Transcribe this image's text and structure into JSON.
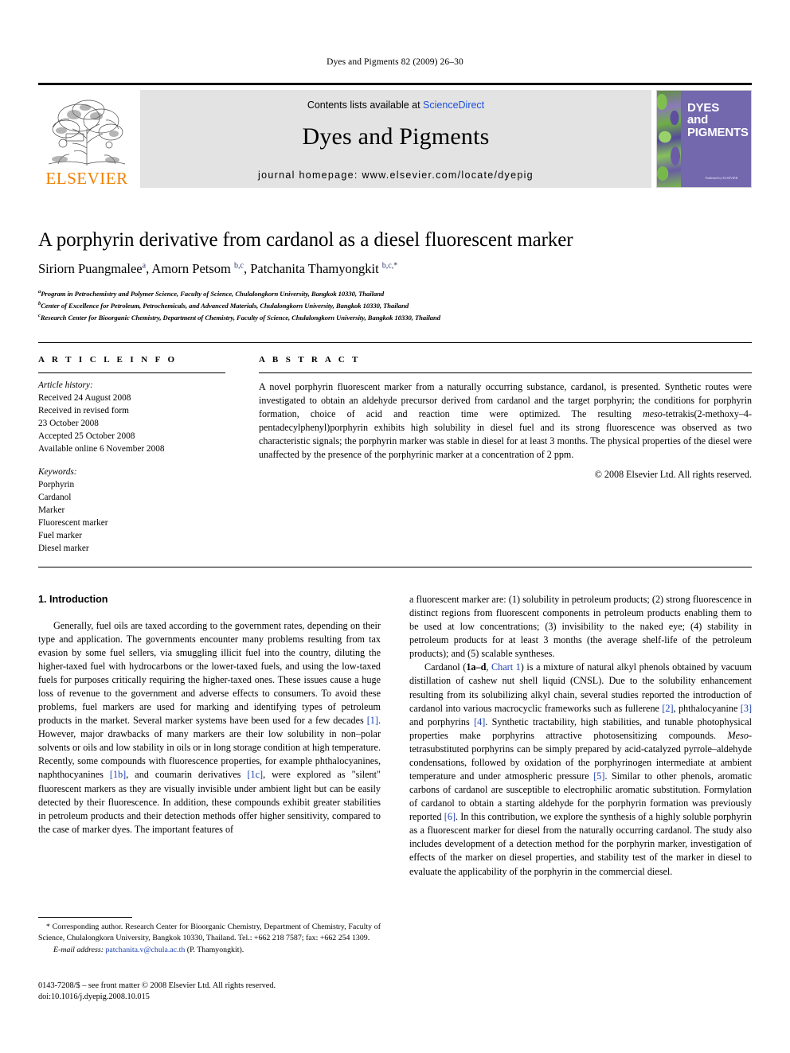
{
  "running_head": "Dyes and Pigments 82 (2009) 26–30",
  "masthead": {
    "publisher_wordmark": "ELSEVIER",
    "contents_prefix": "Contents lists available at ",
    "contents_link": "ScienceDirect",
    "journal_name": "Dyes and Pigments",
    "homepage": "journal homepage: www.elsevier.com/locate/dyepig",
    "cover": {
      "line1": "DYES",
      "line2": "and",
      "line3": "PIGMENTS",
      "footer": "Published by ELSEVIER",
      "background_color": "#7367AE",
      "wordmark_color": "#F08000"
    }
  },
  "article": {
    "title": "A porphyrin derivative from cardanol as a diesel fluorescent marker",
    "authors": [
      {
        "name": "Siriorn Puangmalee",
        "marks": "a"
      },
      {
        "name": "Amorn Petsom",
        "marks": "b,c"
      },
      {
        "name": "Patchanita Thamyongkit",
        "marks": "b,c,*"
      }
    ],
    "authors_line": "Siriorn Puangmalee a, Amorn Petsom b,c, Patchanita Thamyongkit b,c,*",
    "affiliations": [
      {
        "mark": "a",
        "text": "Program in Petrochemistry and Polymer Science, Faculty of Science, Chulalongkorn University, Bangkok 10330, Thailand"
      },
      {
        "mark": "b",
        "text": "Center of Excellence for Petroleum, Petrochemicals, and Advanced Materials, Chulalongkorn University, Bangkok 10330, Thailand"
      },
      {
        "mark": "c",
        "text": "Research Center for Bioorganic Chemistry, Department of Chemistry, Faculty of Science, Chulalongkorn University, Bangkok 10330, Thailand"
      }
    ]
  },
  "article_info": {
    "heading": "A R T I C L E   I N F O",
    "history_label": "Article history:",
    "history": [
      "Received 24 August 2008",
      "Received in revised form",
      "23 October 2008",
      "Accepted 25 October 2008",
      "Available online 6 November 2008"
    ],
    "keywords_label": "Keywords:",
    "keywords": [
      "Porphyrin",
      "Cardanol",
      "Marker",
      "Fluorescent marker",
      "Fuel marker",
      "Diesel marker"
    ]
  },
  "abstract": {
    "heading": "A B S T R A C T",
    "text": "A novel porphyrin fluorescent marker from a naturally occurring substance, cardanol, is presented. Synthetic routes were investigated to obtain an aldehyde precursor derived from cardanol and the target porphyrin; the conditions for porphyrin formation, choice of acid and reaction time were optimized. The resulting meso-tetrakis(2-methoxy–4-pentadecylphenyl)porphyrin exhibits high solubility in diesel fuel and its strong fluorescence was observed as two characteristic signals; the porphyrin marker was stable in diesel for at least 3 months. The physical properties of the diesel were unaffected by the presence of the porphyrinic marker at a concentration of 2 ppm.",
    "copyright": "© 2008 Elsevier Ltd. All rights reserved."
  },
  "body": {
    "section_number_title": "1.  Introduction",
    "left_paragraph": "Generally, fuel oils are taxed according to the government rates, depending on their type and application. The governments encounter many problems resulting from tax evasion by some fuel sellers, via smuggling illicit fuel into the country, diluting the higher-taxed fuel with hydrocarbons or the lower-taxed fuels, and using the low-taxed fuels for purposes critically requiring the higher-taxed ones. These issues cause a huge loss of revenue to the government and adverse effects to consumers. To avoid these problems, fuel markers are used for marking and identifying types of petroleum products in the market. Several marker systems have been used for a few decades [1]. However, major drawbacks of many markers are their low solubility in non–polar solvents or oils and low stability in oils or in long storage condition at high temperature. Recently, some compounds with fluorescence properties, for example phthalocyanines, naphthocyanines [1b], and coumarin derivatives [1c], were explored as \"silent\" fluorescent markers as they are visually invisible under ambient light but can be easily detected by their fluorescence. In addition, these compounds exhibit greater stabilities in petroleum products and their detection methods offer higher sensitivity, compared to the case of marker dyes. The important features of",
    "right_paragraph_1": "a fluorescent marker are: (1) solubility in petroleum products; (2) strong fluorescence in distinct regions from fluorescent components in petroleum products enabling them to be used at low concentrations; (3) invisibility to the naked eye; (4) stability in petroleum products for at least 3 months (the average shelf-life of the petroleum products); and (5) scalable syntheses.",
    "right_paragraph_2": "Cardanol (1a–d, Chart 1) is a mixture of natural alkyl phenols obtained by vacuum distillation of cashew nut shell liquid (CNSL). Due to the solubility enhancement resulting from its solubilizing alkyl chain, several studies reported the introduction of cardanol into various macrocyclic frameworks such as fullerene [2], phthalocyanine [3] and porphyrins [4]. Synthetic tractability, high stabilities, and tunable photophysical properties make porphyrins attractive photosensitizing compounds. Meso-tetrasubstituted porphyrins can be simply prepared by acid-catalyzed pyrrole–aldehyde condensations, followed by oxidation of the porphyrinogen intermediate at ambient temperature and under atmospheric pressure [5]. Similar to other phenols, aromatic carbons of cardanol are susceptible to electrophilic aromatic substitution. Formylation of cardanol to obtain a starting aldehyde for the porphyrin formation was previously reported [6]. In this contribution, we explore the synthesis of a highly soluble porphyrin as a fluorescent marker for diesel from the naturally occurring cardanol. The study also includes development of a detection method for the porphyrin marker, investigation of effects of the marker on diesel properties, and stability test of the marker in diesel to evaluate the applicability of the porphyrin in the commercial diesel."
  },
  "footnote": {
    "corresponding": "* Corresponding author. Research Center for Bioorganic Chemistry, Department of Chemistry, Faculty of Science, Chulalongkorn University, Bangkok 10330, Thailand. Tel.: +662 218 7587; fax: +662 254 1309.",
    "email_label": "E-mail address:",
    "email_address": "patchanita.v@chula.ac.th",
    "email_owner": "(P. Thamyongkit)."
  },
  "imprint": {
    "issn_line": "0143-7208/$ – see front matter © 2008 Elsevier Ltd. All rights reserved.",
    "doi_line": "doi:10.1016/j.dyepig.2008.10.015"
  }
}
